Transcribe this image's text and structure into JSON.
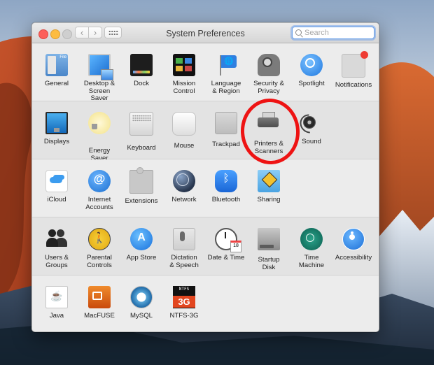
{
  "window": {
    "title": "System Preferences",
    "search": {
      "placeholder": "Search",
      "value": ""
    }
  },
  "sections": [
    {
      "panes": [
        {
          "label": "General",
          "icon": "general-icon"
        },
        {
          "label": "Desktop & Screen Saver",
          "icon": "desktop-icon"
        },
        {
          "label": "Dock",
          "icon": "dock-icon"
        },
        {
          "label": "Mission Control",
          "icon": "mission-control-icon"
        },
        {
          "label": "Language & Region",
          "icon": "language-flag-icon"
        },
        {
          "label": "Security & Privacy",
          "icon": "security-house-icon"
        },
        {
          "label": "Spotlight",
          "icon": "spotlight-icon"
        },
        {
          "label": "Notifications",
          "icon": "notifications-icon"
        }
      ]
    },
    {
      "panes": [
        {
          "label": "Displays",
          "icon": "displays-icon"
        },
        {
          "label": "Energy Saver",
          "icon": "lightbulb-icon"
        },
        {
          "label": "Keyboard",
          "icon": "keyboard-icon"
        },
        {
          "label": "Mouse",
          "icon": "mouse-icon"
        },
        {
          "label": "Trackpad",
          "icon": "trackpad-icon"
        },
        {
          "label": "Printers & Scanners",
          "icon": "printer-icon"
        },
        {
          "label": "Sound",
          "icon": "speaker-icon"
        }
      ]
    },
    {
      "panes": [
        {
          "label": "iCloud",
          "icon": "icloud-icon"
        },
        {
          "label": "Internet Accounts",
          "icon": "at-sign-icon"
        },
        {
          "label": "Extensions",
          "icon": "puzzle-icon"
        },
        {
          "label": "Network",
          "icon": "globe-icon"
        },
        {
          "label": "Bluetooth",
          "icon": "bluetooth-icon"
        },
        {
          "label": "Sharing",
          "icon": "sharing-folder-icon"
        }
      ]
    },
    {
      "panes": [
        {
          "label": "Users & Groups",
          "icon": "users-icon"
        },
        {
          "label": "Parental Controls",
          "icon": "parental-controls-icon"
        },
        {
          "label": "App Store",
          "icon": "app-store-icon"
        },
        {
          "label": "Dictation & Speech",
          "icon": "microphone-icon"
        },
        {
          "label": "Date & Time",
          "icon": "clock-calendar-icon"
        },
        {
          "label": "Startup Disk",
          "icon": "disk-icon"
        },
        {
          "label": "Time Machine",
          "icon": "time-machine-icon"
        },
        {
          "label": "Accessibility",
          "icon": "accessibility-icon"
        }
      ]
    },
    {
      "panes": [
        {
          "label": "Java",
          "icon": "java-icon"
        },
        {
          "label": "MacFUSE",
          "icon": "macfuse-icon"
        },
        {
          "label": "MySQL",
          "icon": "mysql-icon"
        },
        {
          "label": "NTFS-3G",
          "icon": "ntfs-3g-icon",
          "icon_text": [
            "NTFS",
            "3G"
          ]
        }
      ]
    }
  ],
  "annotation": {
    "color": "#ee1313",
    "target": "Printers & Scanners"
  }
}
